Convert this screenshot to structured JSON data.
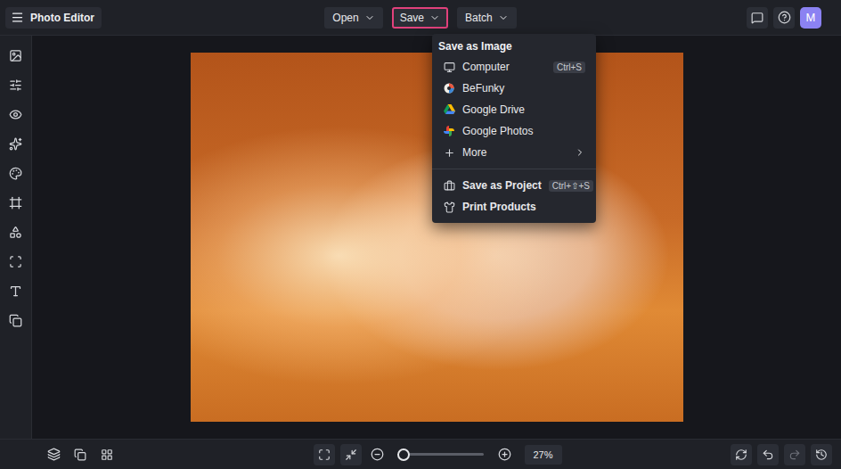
{
  "app": {
    "title": "Photo Editor"
  },
  "menu_buttons": [
    {
      "label": "Open",
      "selected": false
    },
    {
      "label": "Save",
      "selected": true
    },
    {
      "label": "Batch",
      "selected": false
    }
  ],
  "avatar": {
    "initial": "M"
  },
  "dropdown": {
    "sections": [
      {
        "heading": "Save as Image",
        "items": [
          {
            "label": "Computer",
            "shortcut": "Ctrl+S",
            "submenu": false,
            "emphasis": false
          },
          {
            "label": "BeFunky",
            "shortcut": "",
            "submenu": false,
            "emphasis": false
          },
          {
            "label": "Google Drive",
            "shortcut": "",
            "submenu": false,
            "emphasis": false
          },
          {
            "label": "Google Photos",
            "shortcut": "",
            "submenu": false,
            "emphasis": false
          },
          {
            "label": "More",
            "shortcut": "",
            "submenu": true,
            "emphasis": false
          }
        ]
      },
      {
        "heading": "",
        "items": [
          {
            "label": "Save as Project",
            "shortcut": "Ctrl+⇧+S",
            "submenu": false,
            "emphasis": true
          },
          {
            "label": "Print Products",
            "shortcut": "",
            "submenu": false,
            "emphasis": true
          }
        ]
      }
    ]
  },
  "zoom": {
    "level": 0.06,
    "reading": "27%"
  },
  "history": {
    "undo_disabled": false,
    "redo_disabled": true
  }
}
